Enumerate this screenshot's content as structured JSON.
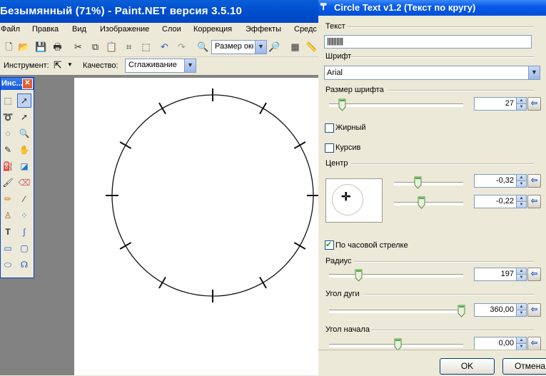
{
  "main": {
    "title": "Безымянный (71%) - Paint.NET версия 3.5.10",
    "menu": [
      "Файл",
      "Правка",
      "Вид",
      "Изображение",
      "Слои",
      "Коррекция",
      "Эффекты",
      "Средс"
    ],
    "zoom_value": "Размер окн",
    "tool_label": "Инструмент:",
    "quality_label": "Качество:",
    "quality_value": "Сглаживание",
    "tools_title": "Инс...",
    "tools_close": "✕"
  },
  "dialog": {
    "title": "Circle Text v1.2 (Текст по кругу)",
    "text_label": "Текст",
    "text_value": "||||||||||||",
    "font_label": "Шрифт",
    "font_value": "Arial",
    "font_size_label": "Размер шрифта",
    "font_size_value": "27",
    "bold_label": "Жирный",
    "bold_checked": false,
    "italic_label": "Курсив",
    "italic_checked": false,
    "center_label": "Центр",
    "center_x": "-0,32",
    "center_y": "-0,22",
    "clockwise_label": "По часовой стрелке",
    "clockwise_checked": true,
    "radius_label": "Радиус",
    "radius_value": "197",
    "arc_angle_label": "Угол дуги",
    "arc_angle_value": "360,00",
    "start_angle_label": "Угол начала",
    "start_angle_value": "0,00",
    "ok_label": "OK",
    "cancel_label": "Отмена"
  }
}
